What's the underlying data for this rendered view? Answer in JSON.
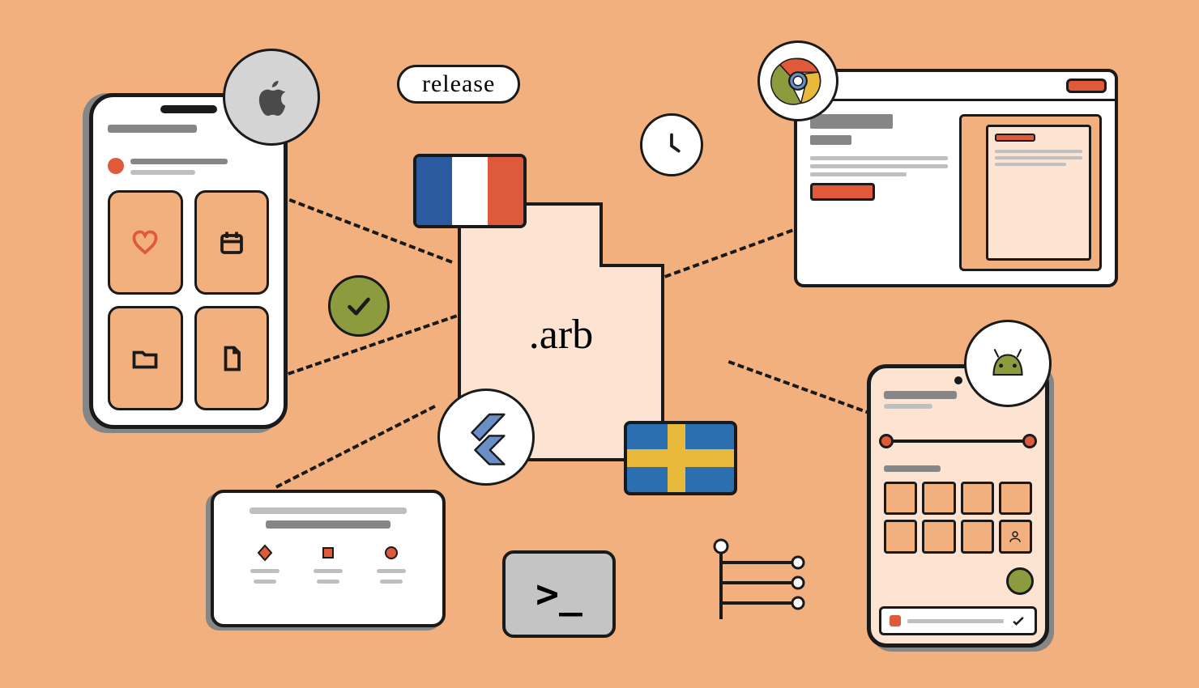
{
  "labels": {
    "release": "release",
    "file_ext": ".arb",
    "terminal_prompt": ">_"
  },
  "platforms": {
    "ios": "apple-icon",
    "web": "chrome-icon",
    "android": "android-icon",
    "sdk": "flutter-icon"
  },
  "flags": [
    "france",
    "sweden"
  ],
  "status": {
    "check": true,
    "clock": true
  },
  "iphone_cards": [
    "heart-icon",
    "calendar-icon",
    "folder-icon",
    "file-icon"
  ],
  "android_tiles": 8,
  "colors": {
    "bg": "#f2b07e",
    "accent": "#de5a3a",
    "olive": "#8b9b3e",
    "blue": "#2c6fb0",
    "yellow": "#e9b93c",
    "gray": "#868686",
    "ink": "#1a1a1a",
    "paper": "#fce3d2"
  }
}
